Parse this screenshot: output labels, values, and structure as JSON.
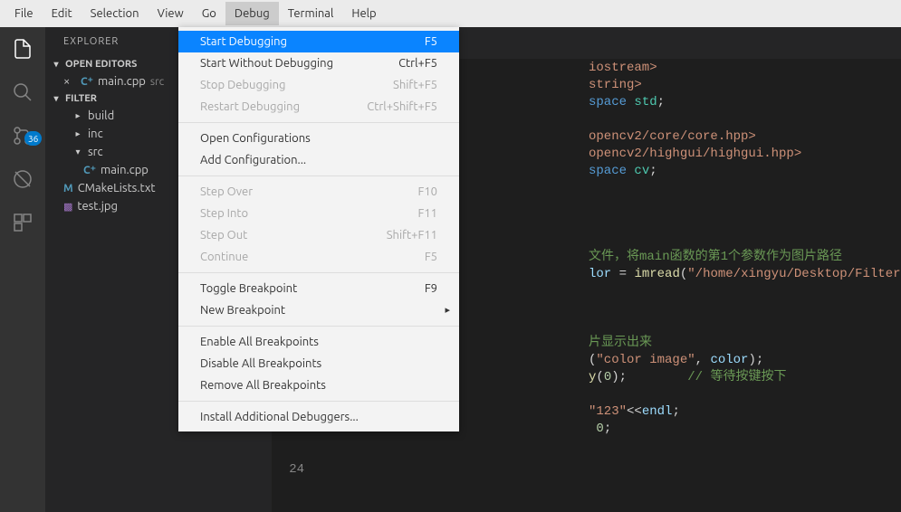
{
  "menubar": [
    "File",
    "Edit",
    "Selection",
    "View",
    "Go",
    "Debug",
    "Terminal",
    "Help"
  ],
  "menubar_active_index": 5,
  "dropdown": {
    "groups": [
      [
        {
          "label": "Start Debugging",
          "shortcut": "F5",
          "hl": true
        },
        {
          "label": "Start Without Debugging",
          "shortcut": "Ctrl+F5"
        },
        {
          "label": "Stop Debugging",
          "shortcut": "Shift+F5",
          "disabled": true
        },
        {
          "label": "Restart Debugging",
          "shortcut": "Ctrl+Shift+F5",
          "disabled": true
        }
      ],
      [
        {
          "label": "Open Configurations"
        },
        {
          "label": "Add Configuration..."
        }
      ],
      [
        {
          "label": "Step Over",
          "shortcut": "F10",
          "disabled": true
        },
        {
          "label": "Step Into",
          "shortcut": "F11",
          "disabled": true
        },
        {
          "label": "Step Out",
          "shortcut": "Shift+F11",
          "disabled": true
        },
        {
          "label": "Continue",
          "shortcut": "F5",
          "disabled": true
        }
      ],
      [
        {
          "label": "Toggle Breakpoint",
          "shortcut": "F9"
        },
        {
          "label": "New Breakpoint",
          "submenu": true
        }
      ],
      [
        {
          "label": "Enable All Breakpoints"
        },
        {
          "label": "Disable All Breakpoints"
        },
        {
          "label": "Remove All Breakpoints"
        }
      ],
      [
        {
          "label": "Install Additional Debuggers..."
        }
      ]
    ]
  },
  "sidebar": {
    "title": "EXPLORER",
    "open_editors_label": "OPEN EDITORS",
    "open_editors": {
      "file": "main.cpp",
      "folder": "src"
    },
    "project_label": "FILTER",
    "tree": {
      "build": "build",
      "inc": "inc",
      "src": "src",
      "src_file": "main.cpp",
      "cmake": "CMakeLists.txt",
      "test": "test.jpg"
    }
  },
  "activity_badge": "36",
  "code": {
    "l3": {
      "a": "iostream>"
    },
    "l4": {
      "a": "string>"
    },
    "l5": {
      "a": "space ",
      "b": "std",
      "c": ";"
    },
    "l7": {
      "a": "opencv2/core/core.hpp>"
    },
    "l8": {
      "a": "opencv2/highgui/highgui.hpp>"
    },
    "l9": {
      "a": "space ",
      "b": "cv",
      "c": ";"
    },
    "l14": {
      "a": "文件，将main函数的第1个参数作为图片路径"
    },
    "l15": {
      "a": "lor",
      "b": " = ",
      "c": "imread",
      "d": "(",
      "e": "\"/home/xingyu/Desktop/Filter/test.jpg\"",
      "f": ");"
    },
    "l19": {
      "a": "片显示出来"
    },
    "l20": {
      "a": "(",
      "b": "\"color image\"",
      "c": ", ",
      "d": "color",
      "e": ");"
    },
    "l21": {
      "a": "y",
      "b": "(",
      "c": "0",
      "d": ");        ",
      "e": "// 等待按键按下"
    },
    "l23": {
      "a": "\"123\"",
      "b": "<<",
      "c": "endl",
      "d": ";"
    },
    "l24": {
      "a": "0",
      "b": ";"
    },
    "last_num": "24"
  }
}
